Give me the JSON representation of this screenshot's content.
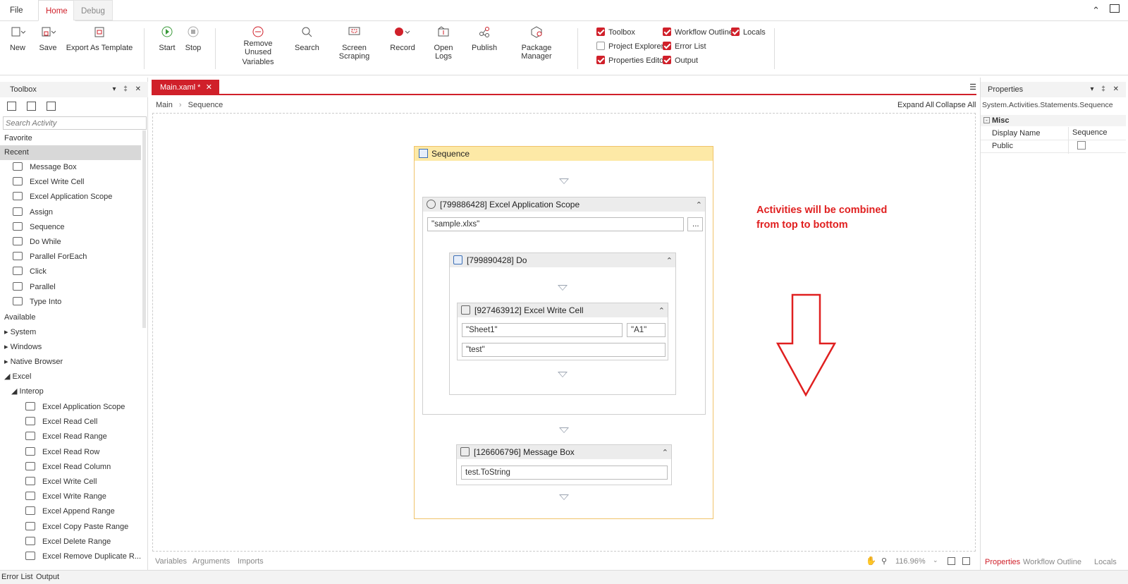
{
  "menu": {
    "file": "File",
    "home": "Home",
    "debug": "Debug"
  },
  "ribbon": {
    "new": "New",
    "save": "Save",
    "export_template": "Export As Template",
    "start": "Start",
    "stop": "Stop",
    "remove_unused_1": "Remove Unused",
    "remove_unused_2": "Variables",
    "search": "Search",
    "screen_scraping": "Screen Scraping",
    "record": "Record",
    "open_logs": "Open Logs",
    "publish": "Publish",
    "package_manager": "Package Manager",
    "checks": [
      {
        "label": "Toolbox",
        "checked": true
      },
      {
        "label": "Project Explorer",
        "checked": false
      },
      {
        "label": "Properties Editor",
        "checked": true
      },
      {
        "label": "Workflow Outline",
        "checked": true
      },
      {
        "label": "Error List",
        "checked": true
      },
      {
        "label": "Output",
        "checked": true
      },
      {
        "label": "Locals",
        "checked": true
      }
    ]
  },
  "toolbox": {
    "title": "Toolbox",
    "search_placeholder": "Search Activity",
    "favorite": "Favorite",
    "recent": "Recent",
    "recent_items": [
      "Message Box",
      "Excel Write Cell",
      "Excel Application Scope",
      "Assign",
      "Sequence",
      "Do While",
      "Parallel ForEach",
      "Click",
      "Parallel",
      "Type Into"
    ],
    "available": "Available",
    "groups": [
      "System",
      "Windows",
      "Native Browser",
      "Excel"
    ],
    "interop": "Interop",
    "interop_items": [
      "Excel Application Scope",
      "Excel Read Cell",
      "Excel Read Range",
      "Excel Read Row",
      "Excel Read Column",
      "Excel Write Cell",
      "Excel Write Range",
      "Excel Append Range",
      "Excel Copy Paste Range",
      "Excel Delete Range",
      "Excel Remove Duplicate R..."
    ]
  },
  "document": {
    "tab": "Main.xaml *",
    "breadcrumb": [
      "Main",
      "Sequence"
    ],
    "expand_all": "Expand All",
    "collapse_all": "Collapse All"
  },
  "workflow": {
    "sequence": "Sequence",
    "app_scope": "[799886428] Excel Application Scope",
    "app_scope_path": "\"sample.xlxs\"",
    "browse": "...",
    "do": "[799890428] Do",
    "write_cell": "[927463912] Excel Write Cell",
    "sheet": "\"Sheet1\"",
    "cell": "\"A1\"",
    "value": "\"test\"",
    "message_box": "[126606796] Message Box",
    "message_text": "test.ToString"
  },
  "annotation": {
    "line1": "Activities will be combined",
    "line2": "from top to bottom",
    "color": "#e02020"
  },
  "designer_footer": {
    "variables": "Variables",
    "arguments": "Arguments",
    "imports": "Imports",
    "zoom": "116.96%"
  },
  "properties": {
    "title": "Properties",
    "type": "System.Activities.Statements.Sequence",
    "category": "Misc",
    "rows": [
      {
        "name": "Display Name",
        "value": "Sequence"
      },
      {
        "name": "Public",
        "value": ""
      }
    ],
    "tabs": [
      "Properties",
      "Workflow Outline",
      "Locals"
    ]
  },
  "statusbar": {
    "error_list": "Error List",
    "output": "Output"
  },
  "colors": {
    "accent": "#d0202a",
    "sequence_header": "#fde9a6",
    "sequence_border": "#f0c36a"
  }
}
